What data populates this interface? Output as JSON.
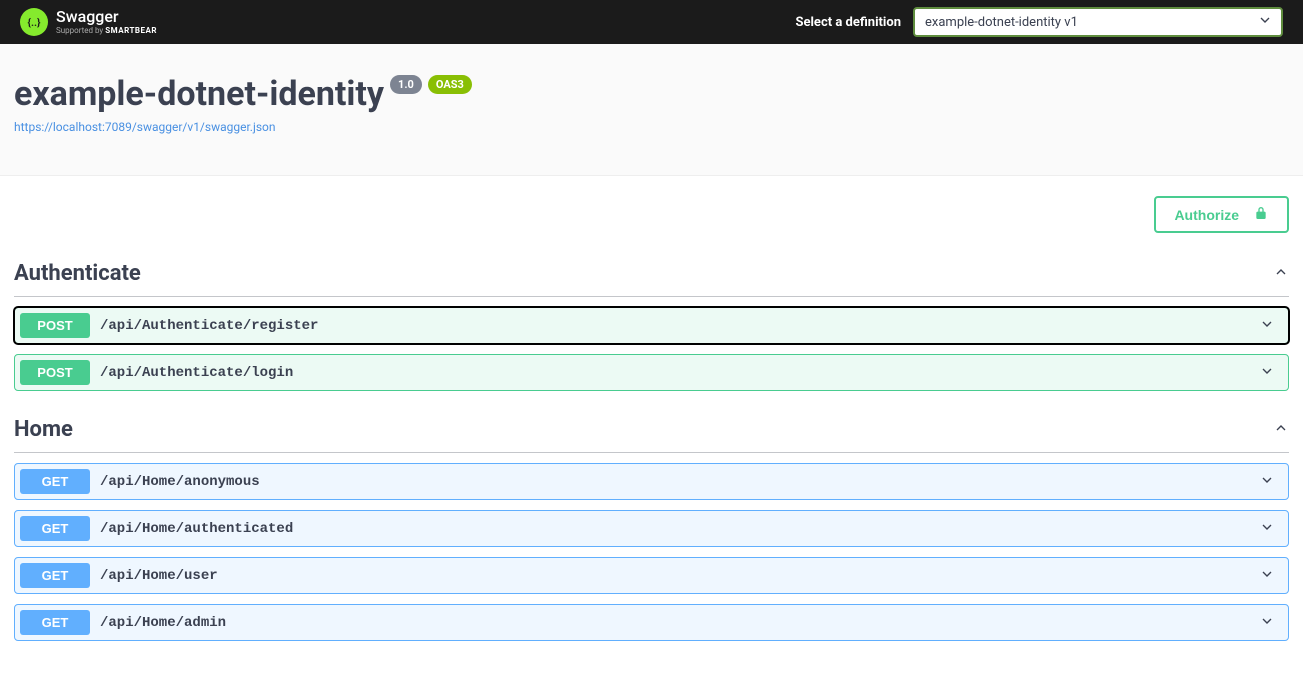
{
  "topbar": {
    "brand_name": "Swagger",
    "brand_sub_prefix": "Supported by ",
    "brand_sub_bold": "SMARTBEAR",
    "select_label": "Select a definition",
    "selected_definition": "example-dotnet-identity v1"
  },
  "info": {
    "title": "example-dotnet-identity",
    "version": "1.0",
    "oas_badge": "OAS3",
    "spec_url": "https://localhost:7089/swagger/v1/swagger.json"
  },
  "authorize_label": "Authorize",
  "tags": [
    {
      "name": "Authenticate",
      "operations": [
        {
          "method": "POST",
          "method_class": "post",
          "path": "/api/Authenticate/register",
          "focused": true
        },
        {
          "method": "POST",
          "method_class": "post",
          "path": "/api/Authenticate/login",
          "focused": false
        }
      ]
    },
    {
      "name": "Home",
      "operations": [
        {
          "method": "GET",
          "method_class": "get",
          "path": "/api/Home/anonymous",
          "focused": false
        },
        {
          "method": "GET",
          "method_class": "get",
          "path": "/api/Home/authenticated",
          "focused": false
        },
        {
          "method": "GET",
          "method_class": "get",
          "path": "/api/Home/user",
          "focused": false
        },
        {
          "method": "GET",
          "method_class": "get",
          "path": "/api/Home/admin",
          "focused": false
        }
      ]
    }
  ]
}
